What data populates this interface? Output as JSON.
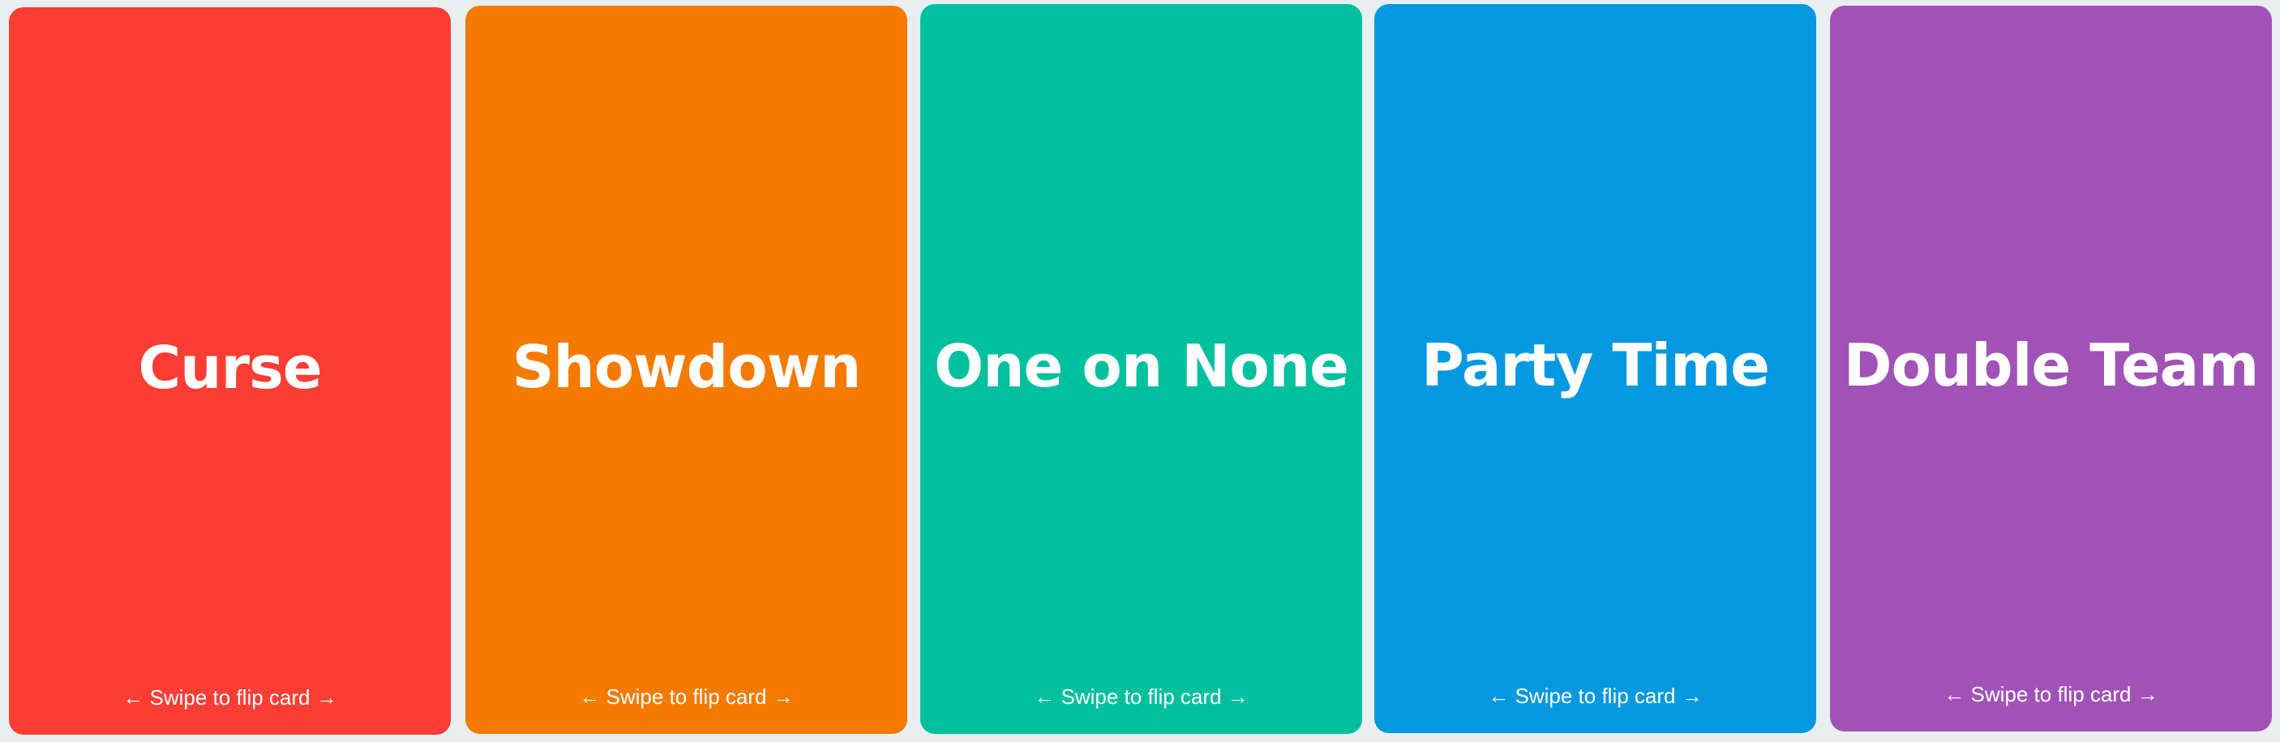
{
  "cards": [
    {
      "title": "Curse",
      "hint": "← Swipe to flip card →",
      "color": "#fb3d33"
    },
    {
      "title": "Showdown",
      "hint": "← Swipe to flip card →",
      "color": "#f47a00"
    },
    {
      "title": "One on None",
      "hint": "← Swipe to flip card →",
      "color": "#01c09e"
    },
    {
      "title": "Party Time",
      "hint": "← Swipe to flip card →",
      "color": "#0299e0"
    },
    {
      "title": "Double Team",
      "hint": "← Swipe to flip card →",
      "color": "#a152b7"
    }
  ],
  "background": "#e9eff0"
}
